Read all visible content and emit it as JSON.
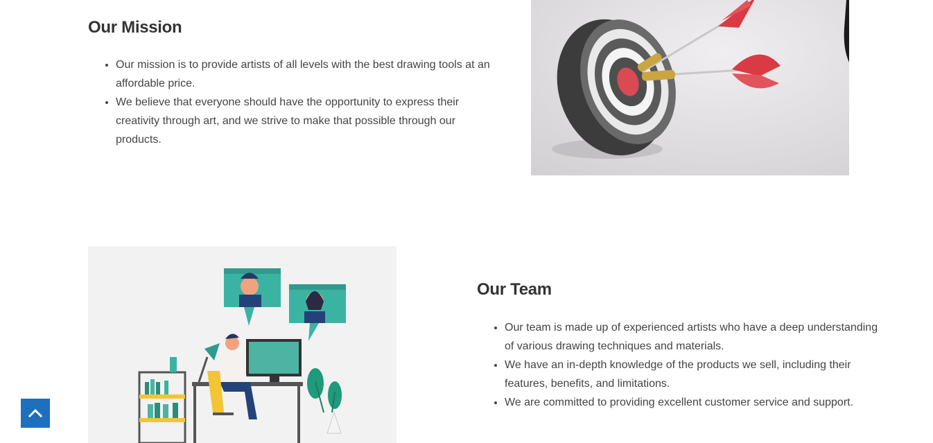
{
  "mission": {
    "title": "Our Mission",
    "items": [
      "Our mission is to provide artists of all levels with the best drawing tools at an affordable price.",
      "We believe that everyone should have the opportunity to express their creativity through art, and we strive to make that possible through our products."
    ]
  },
  "team": {
    "title": "Our Team",
    "items": [
      "Our team is made up of experienced artists who have a deep understanding of various drawing techniques and materials.",
      "We have an in-depth knowledge of the products we sell, including their features, benefits, and limitations.",
      "We are committed to providing excellent customer service and support."
    ]
  },
  "scroll_top": {
    "icon": "chevron-up-icon",
    "color": "#1e6fbd"
  }
}
